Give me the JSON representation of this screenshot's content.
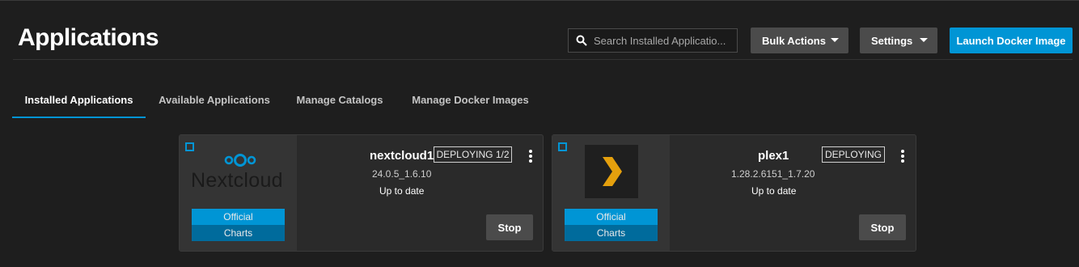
{
  "header": {
    "title": "Applications",
    "search_placeholder": "Search Installed Applicatio...",
    "bulk_actions_label": "Bulk Actions",
    "settings_label": "Settings",
    "launch_label": "Launch Docker Image"
  },
  "tabs": [
    {
      "label": "Installed Applications",
      "active": true
    },
    {
      "label": "Available Applications",
      "active": false
    },
    {
      "label": "Manage Catalogs",
      "active": false
    },
    {
      "label": "Manage Docker Images",
      "active": false
    }
  ],
  "apps": [
    {
      "name": "nextcloud1",
      "status": "DEPLOYING 1/2",
      "version": "24.0.5_1.6.10",
      "update_status": "Up to date",
      "badge_top": "Official",
      "badge_bottom": "Charts",
      "stop_label": "Stop",
      "logo_text": "Nextcloud",
      "logo_icon": "nextcloud-icon"
    },
    {
      "name": "plex1",
      "status": "DEPLOYING",
      "version": "1.28.2.6151_1.7.20",
      "update_status": "Up to date",
      "badge_top": "Official",
      "badge_bottom": "Charts",
      "stop_label": "Stop",
      "logo_icon": "plex-chevron-icon"
    }
  ],
  "colors": {
    "background": "#1e1e1e",
    "card": "#2a2a2a",
    "accent": "#0095d5",
    "accent_dark": "#006b9c",
    "button_grey": "#4b4b4b",
    "plex_orange": "#e5a00d"
  }
}
